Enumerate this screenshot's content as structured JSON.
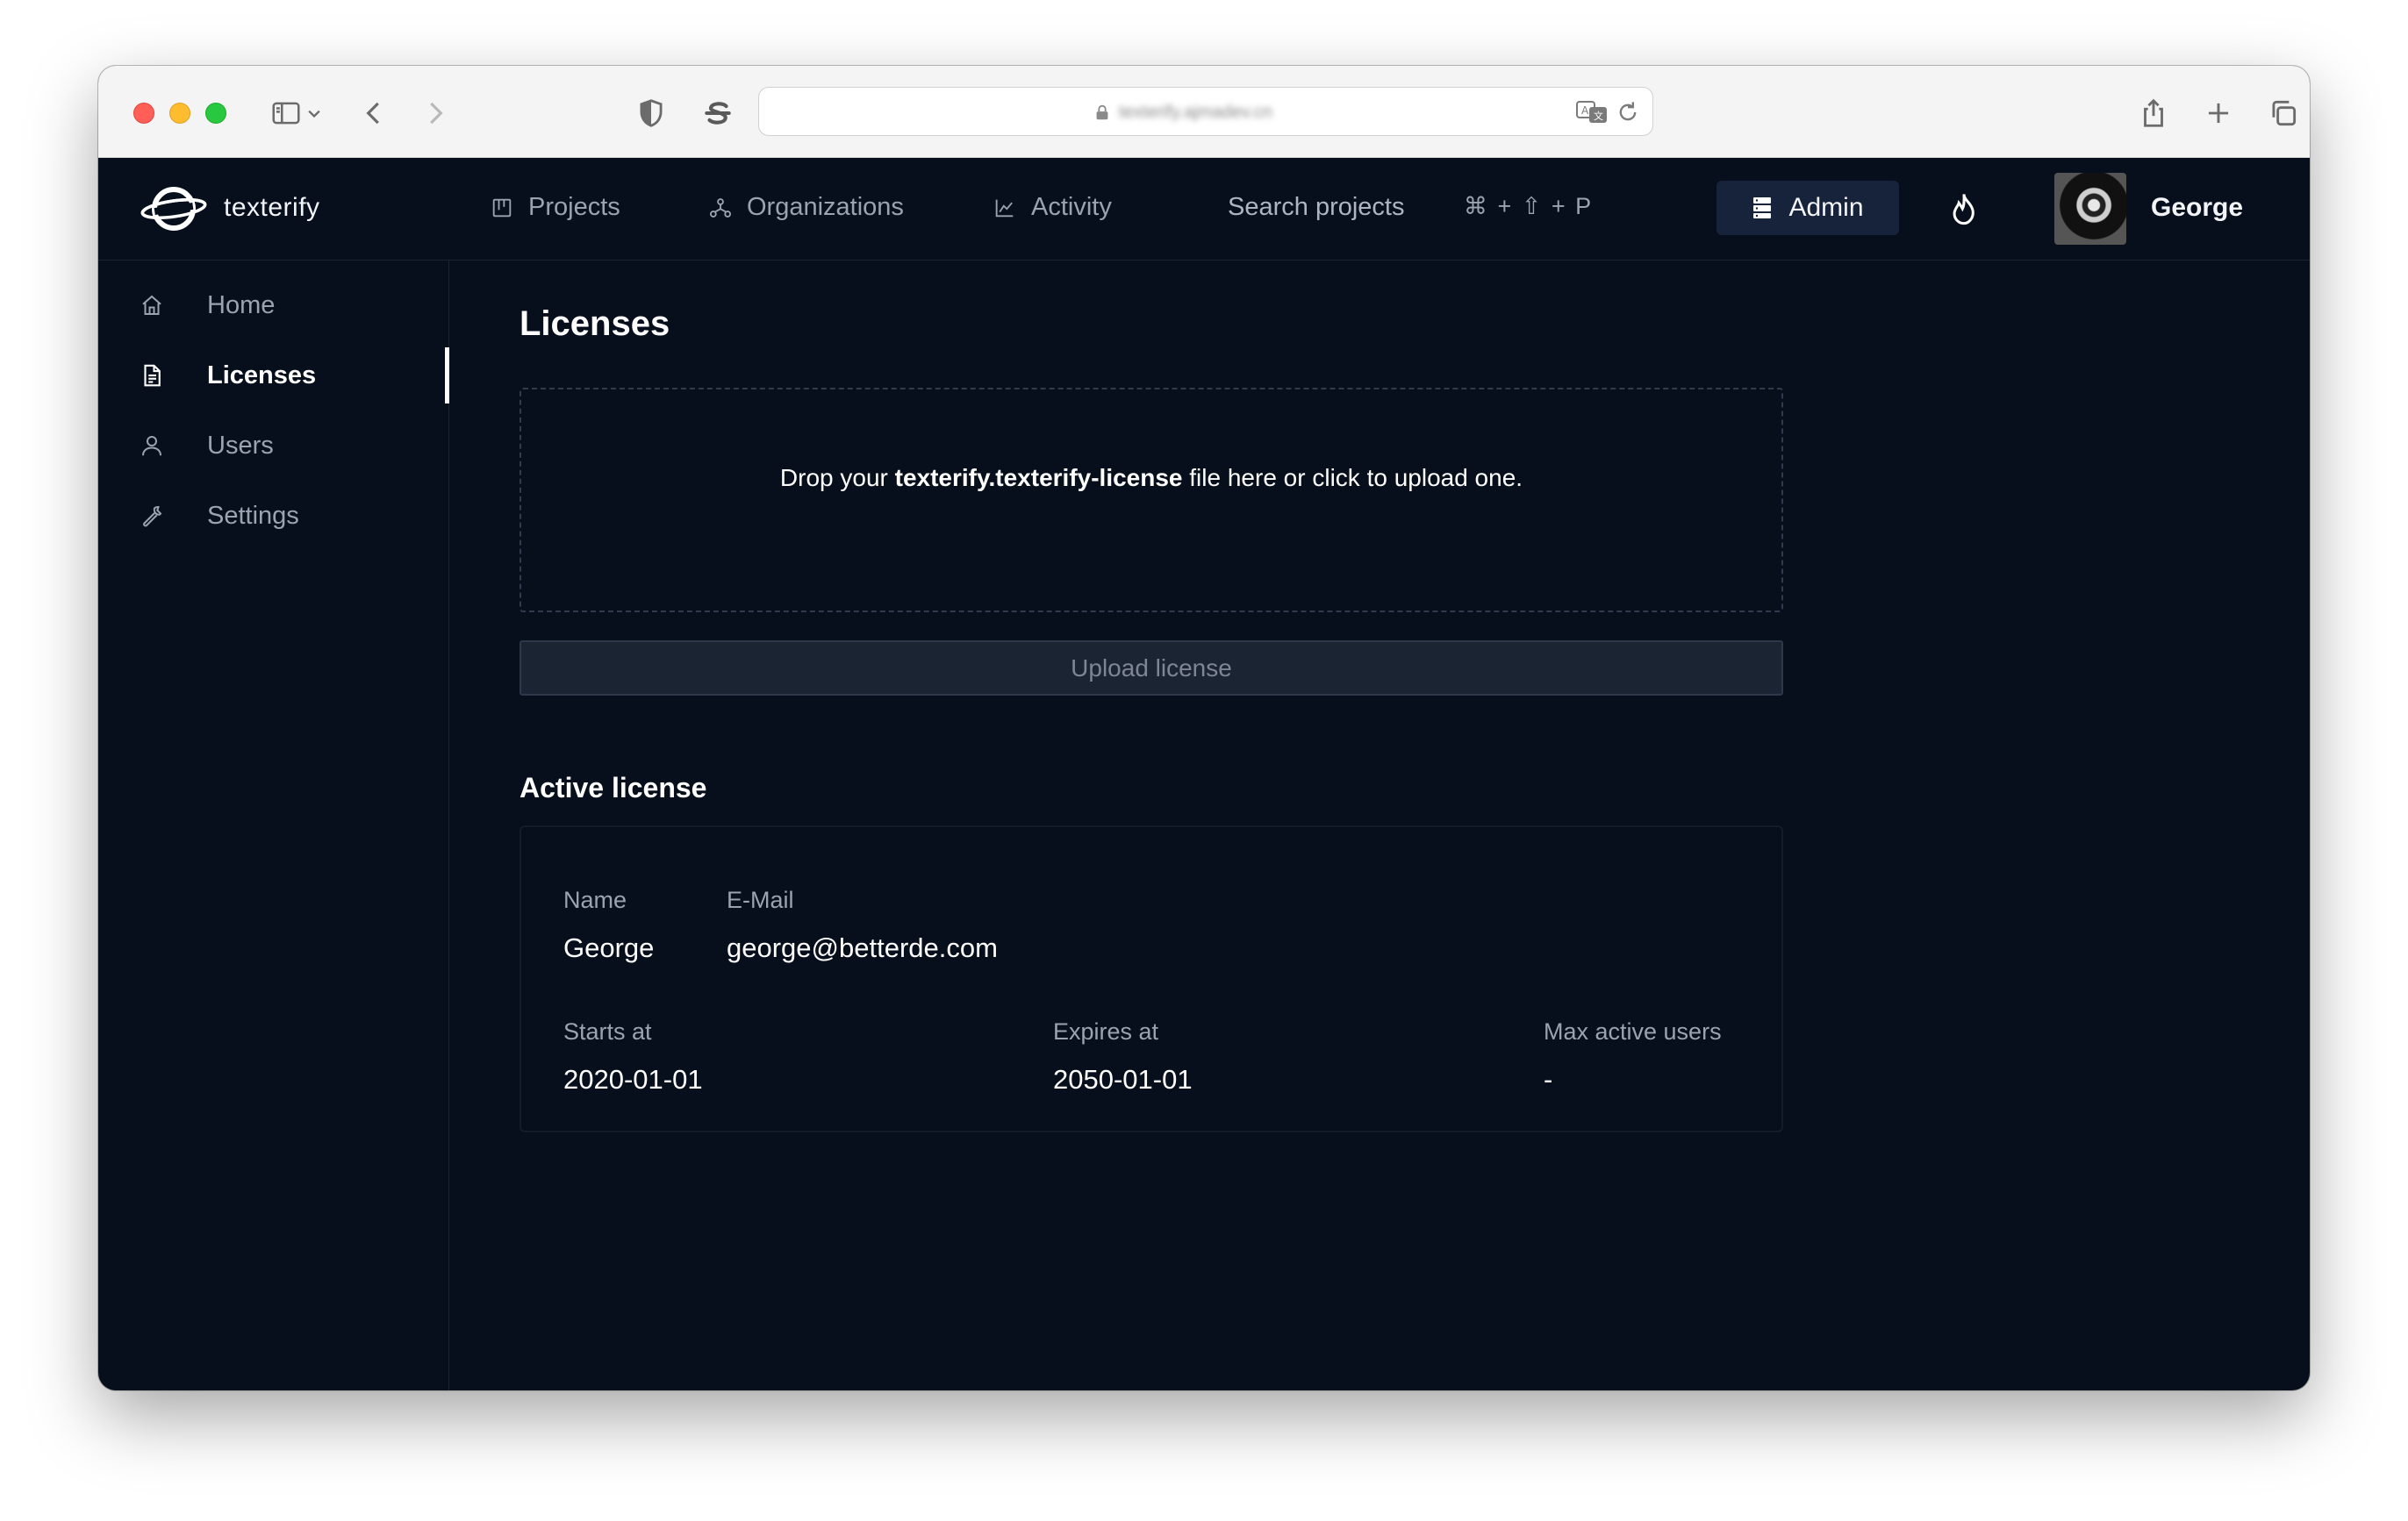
{
  "browser": {
    "address": "texterify.ajmadev.cn"
  },
  "header": {
    "brand": "texterify",
    "nav": [
      {
        "label": "Projects",
        "icon": "projects-icon"
      },
      {
        "label": "Organizations",
        "icon": "organizations-icon"
      },
      {
        "label": "Activity",
        "icon": "activity-icon"
      }
    ],
    "search_label": "Search projects",
    "search_shortcut": "⌘ + ⇧ + P",
    "admin_label": "Admin",
    "user_name": "George"
  },
  "sidebar": {
    "items": [
      {
        "label": "Home",
        "icon": "home-icon",
        "active": false
      },
      {
        "label": "Licenses",
        "icon": "document-icon",
        "active": true
      },
      {
        "label": "Users",
        "icon": "user-icon",
        "active": false
      },
      {
        "label": "Settings",
        "icon": "wrench-icon",
        "active": false
      }
    ]
  },
  "main": {
    "title": "Licenses",
    "dropzone": {
      "prefix": "Drop your ",
      "filename": "texterify.texterify-license",
      "suffix": " file here or click to upload one."
    },
    "upload_button": "Upload license",
    "active_license": {
      "title": "Active license",
      "name_label": "Name",
      "name_value": "George",
      "email_label": "E-Mail",
      "email_value": "george@betterde.com",
      "starts_label": "Starts at",
      "starts_value": "2020-01-01",
      "expires_label": "Expires at",
      "expires_value": "2050-01-01",
      "max_users_label": "Max active users",
      "max_users_value": "-"
    }
  },
  "colors": {
    "background": "#080f1c",
    "admin_button": "#17233b",
    "text_muted": "#9aa3b2",
    "text_primary": "#ffffff"
  }
}
